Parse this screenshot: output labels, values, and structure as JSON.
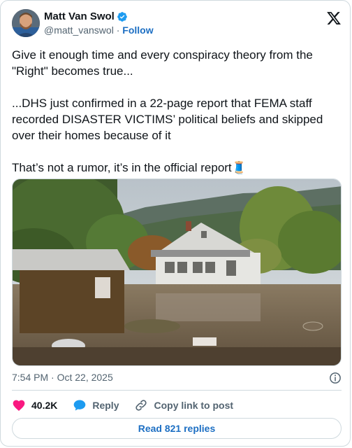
{
  "author": {
    "name": "Matt Van Swol",
    "handle": "@matt_vanswol",
    "separator": "·",
    "follow_label": "Follow"
  },
  "tweet": {
    "paragraphs": [
      "Give it enough time and every conspiracy theory from the \"Right\" becomes true...",
      "...DHS just confirmed in a 22-page report that FEMA staff recorded DISASTER VICTIMS’ political beliefs and skipped over their homes because of it",
      "That’s not a rumor, it’s in the official report"
    ],
    "emoji": "🧵"
  },
  "meta": {
    "time": "7:54 PM",
    "separator": "·",
    "date": "Oct 22, 2025"
  },
  "actions": {
    "likes": "40.2K",
    "reply_label": "Reply",
    "copy_label": "Copy link to post"
  },
  "replies_button": "Read 821 replies",
  "colors": {
    "accent": "#1d6fc3",
    "like": "#f91880",
    "verified": "#1d9bf0",
    "muted": "#536471"
  },
  "icons": [
    "verified-badge-icon",
    "x-logo-icon",
    "info-icon",
    "heart-icon",
    "reply-bubble-icon",
    "link-icon"
  ]
}
